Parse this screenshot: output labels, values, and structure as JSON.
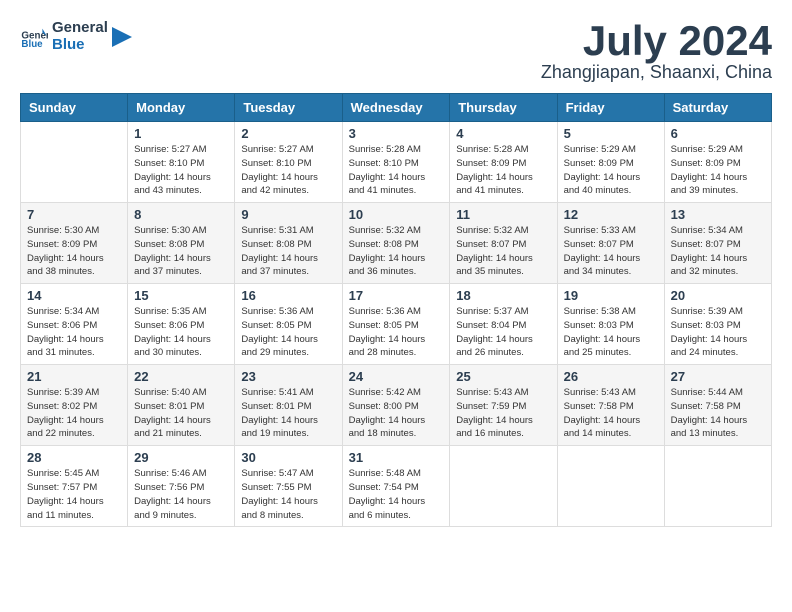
{
  "logo": {
    "text_general": "General",
    "text_blue": "Blue"
  },
  "header": {
    "month": "July 2024",
    "location": "Zhangjiapan, Shaanxi, China"
  },
  "weekdays": [
    "Sunday",
    "Monday",
    "Tuesday",
    "Wednesday",
    "Thursday",
    "Friday",
    "Saturday"
  ],
  "weeks": [
    [
      {
        "day": "",
        "info": ""
      },
      {
        "day": "1",
        "info": "Sunrise: 5:27 AM\nSunset: 8:10 PM\nDaylight: 14 hours\nand 43 minutes."
      },
      {
        "day": "2",
        "info": "Sunrise: 5:27 AM\nSunset: 8:10 PM\nDaylight: 14 hours\nand 42 minutes."
      },
      {
        "day": "3",
        "info": "Sunrise: 5:28 AM\nSunset: 8:10 PM\nDaylight: 14 hours\nand 41 minutes."
      },
      {
        "day": "4",
        "info": "Sunrise: 5:28 AM\nSunset: 8:09 PM\nDaylight: 14 hours\nand 41 minutes."
      },
      {
        "day": "5",
        "info": "Sunrise: 5:29 AM\nSunset: 8:09 PM\nDaylight: 14 hours\nand 40 minutes."
      },
      {
        "day": "6",
        "info": "Sunrise: 5:29 AM\nSunset: 8:09 PM\nDaylight: 14 hours\nand 39 minutes."
      }
    ],
    [
      {
        "day": "7",
        "info": "Sunrise: 5:30 AM\nSunset: 8:09 PM\nDaylight: 14 hours\nand 38 minutes."
      },
      {
        "day": "8",
        "info": "Sunrise: 5:30 AM\nSunset: 8:08 PM\nDaylight: 14 hours\nand 37 minutes."
      },
      {
        "day": "9",
        "info": "Sunrise: 5:31 AM\nSunset: 8:08 PM\nDaylight: 14 hours\nand 37 minutes."
      },
      {
        "day": "10",
        "info": "Sunrise: 5:32 AM\nSunset: 8:08 PM\nDaylight: 14 hours\nand 36 minutes."
      },
      {
        "day": "11",
        "info": "Sunrise: 5:32 AM\nSunset: 8:07 PM\nDaylight: 14 hours\nand 35 minutes."
      },
      {
        "day": "12",
        "info": "Sunrise: 5:33 AM\nSunset: 8:07 PM\nDaylight: 14 hours\nand 34 minutes."
      },
      {
        "day": "13",
        "info": "Sunrise: 5:34 AM\nSunset: 8:07 PM\nDaylight: 14 hours\nand 32 minutes."
      }
    ],
    [
      {
        "day": "14",
        "info": "Sunrise: 5:34 AM\nSunset: 8:06 PM\nDaylight: 14 hours\nand 31 minutes."
      },
      {
        "day": "15",
        "info": "Sunrise: 5:35 AM\nSunset: 8:06 PM\nDaylight: 14 hours\nand 30 minutes."
      },
      {
        "day": "16",
        "info": "Sunrise: 5:36 AM\nSunset: 8:05 PM\nDaylight: 14 hours\nand 29 minutes."
      },
      {
        "day": "17",
        "info": "Sunrise: 5:36 AM\nSunset: 8:05 PM\nDaylight: 14 hours\nand 28 minutes."
      },
      {
        "day": "18",
        "info": "Sunrise: 5:37 AM\nSunset: 8:04 PM\nDaylight: 14 hours\nand 26 minutes."
      },
      {
        "day": "19",
        "info": "Sunrise: 5:38 AM\nSunset: 8:03 PM\nDaylight: 14 hours\nand 25 minutes."
      },
      {
        "day": "20",
        "info": "Sunrise: 5:39 AM\nSunset: 8:03 PM\nDaylight: 14 hours\nand 24 minutes."
      }
    ],
    [
      {
        "day": "21",
        "info": "Sunrise: 5:39 AM\nSunset: 8:02 PM\nDaylight: 14 hours\nand 22 minutes."
      },
      {
        "day": "22",
        "info": "Sunrise: 5:40 AM\nSunset: 8:01 PM\nDaylight: 14 hours\nand 21 minutes."
      },
      {
        "day": "23",
        "info": "Sunrise: 5:41 AM\nSunset: 8:01 PM\nDaylight: 14 hours\nand 19 minutes."
      },
      {
        "day": "24",
        "info": "Sunrise: 5:42 AM\nSunset: 8:00 PM\nDaylight: 14 hours\nand 18 minutes."
      },
      {
        "day": "25",
        "info": "Sunrise: 5:43 AM\nSunset: 7:59 PM\nDaylight: 14 hours\nand 16 minutes."
      },
      {
        "day": "26",
        "info": "Sunrise: 5:43 AM\nSunset: 7:58 PM\nDaylight: 14 hours\nand 14 minutes."
      },
      {
        "day": "27",
        "info": "Sunrise: 5:44 AM\nSunset: 7:58 PM\nDaylight: 14 hours\nand 13 minutes."
      }
    ],
    [
      {
        "day": "28",
        "info": "Sunrise: 5:45 AM\nSunset: 7:57 PM\nDaylight: 14 hours\nand 11 minutes."
      },
      {
        "day": "29",
        "info": "Sunrise: 5:46 AM\nSunset: 7:56 PM\nDaylight: 14 hours\nand 9 minutes."
      },
      {
        "day": "30",
        "info": "Sunrise: 5:47 AM\nSunset: 7:55 PM\nDaylight: 14 hours\nand 8 minutes."
      },
      {
        "day": "31",
        "info": "Sunrise: 5:48 AM\nSunset: 7:54 PM\nDaylight: 14 hours\nand 6 minutes."
      },
      {
        "day": "",
        "info": ""
      },
      {
        "day": "",
        "info": ""
      },
      {
        "day": "",
        "info": ""
      }
    ]
  ]
}
